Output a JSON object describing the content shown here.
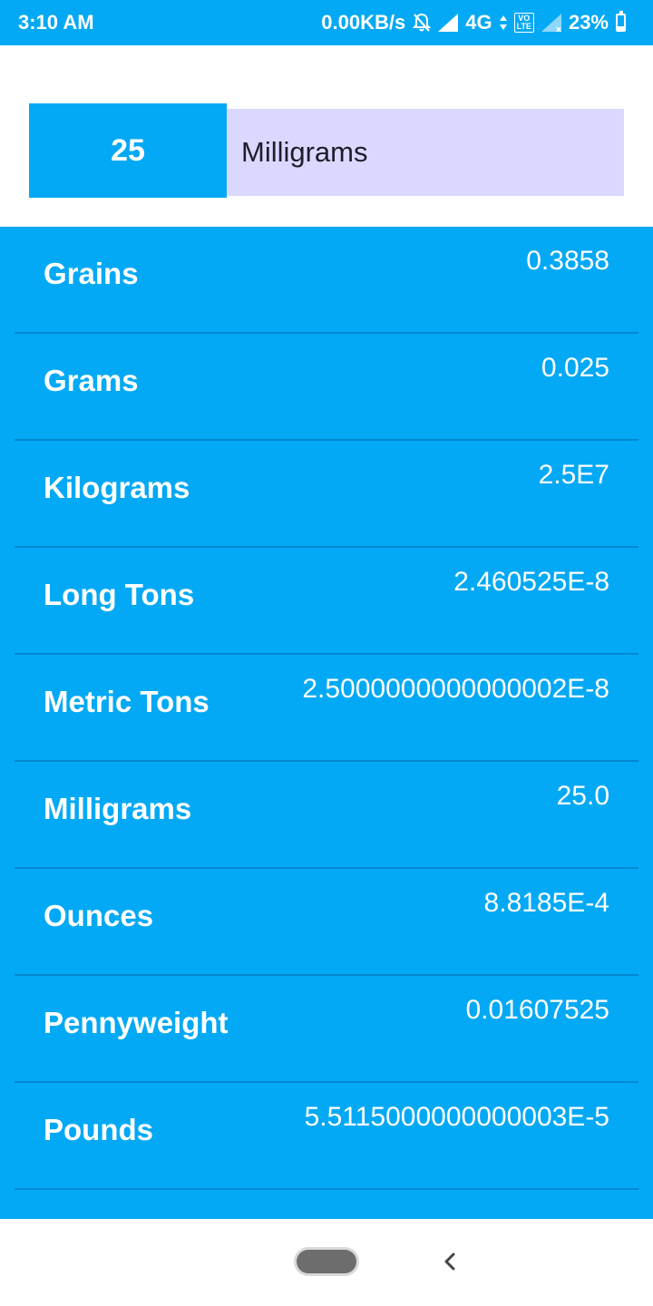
{
  "status_bar": {
    "time": "3:10 AM",
    "network_speed": "0.00KB/s",
    "network_type": "4G",
    "volte_line1": "VO",
    "volte_line2": "LTE",
    "battery": "23%",
    "battery_level": 0.23,
    "icons": [
      "notifications-off-icon",
      "signal-icon",
      "data-arrows-icon",
      "volte-icon",
      "signal-no-service-icon",
      "battery-icon"
    ]
  },
  "converter": {
    "amount": "25",
    "unit": "Milligrams"
  },
  "results": [
    {
      "unit": "Grains",
      "value": "0.3858"
    },
    {
      "unit": "Grams",
      "value": "0.025"
    },
    {
      "unit": "Kilograms",
      "value": "2.5E7"
    },
    {
      "unit": "Long Tons",
      "value": "2.460525E-8"
    },
    {
      "unit": "Metric Tons",
      "value": "2.5000000000000002E-8"
    },
    {
      "unit": "Milligrams",
      "value": "25.0"
    },
    {
      "unit": "Ounces",
      "value": "8.8185E-4"
    },
    {
      "unit": "Pennyweight",
      "value": "0.01607525"
    },
    {
      "unit": "Pounds",
      "value": "5.5115000000000003E-5"
    }
  ],
  "nav_bar": {
    "icons": [
      "home-pill-icon",
      "back-arrow-icon"
    ]
  },
  "colors": {
    "accent": "#03a9f4",
    "divider": "#0288d1",
    "unit_field_bg": "#dbd8ff",
    "text_light": "#ffffff",
    "text_dark": "#1d1d2b"
  }
}
